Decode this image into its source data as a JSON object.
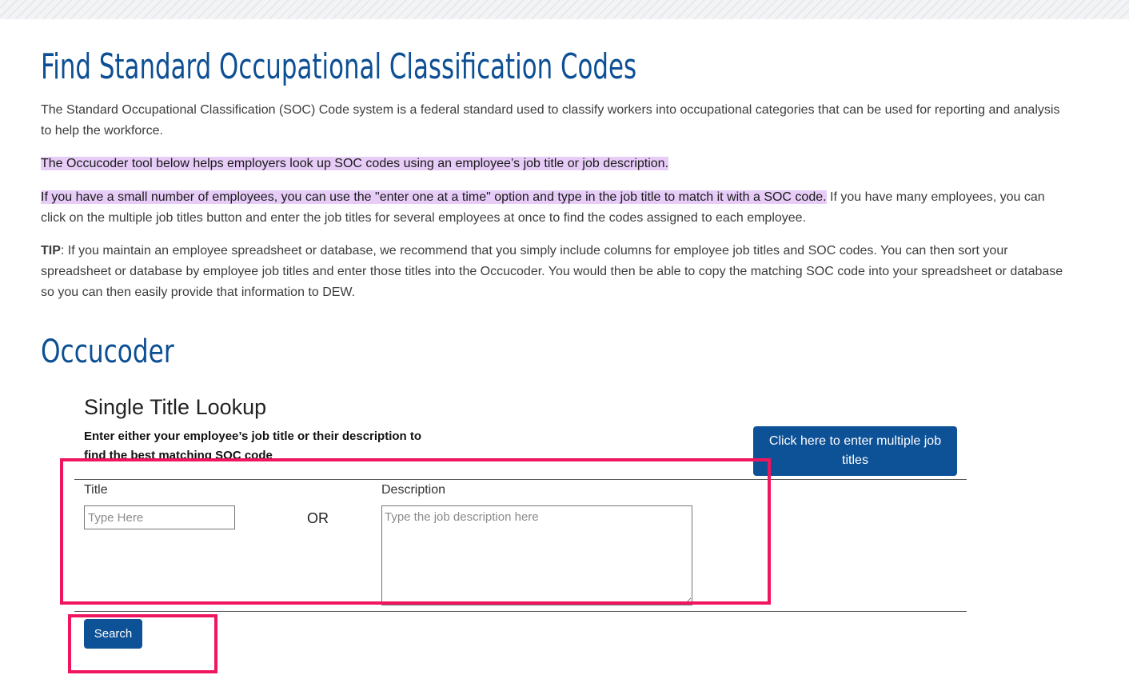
{
  "page": {
    "title": "Find Standard Occupational Classification Codes",
    "intro": "The Standard Occupational Classification (SOC) Code system is a federal standard used to classify workers into occupational categories that can be used for reporting and analysis to help the workforce.",
    "tool_note": "The Occucoder tool below helps employers look up SOC codes using an employee’s job title or job description.",
    "small_count_highlight": "If you have a small number of employees, you can use the \"enter one at a time\" option and type in the job title to match it with a SOC code.",
    "many_count_text": " If you have many employees, you can click on the multiple job titles button and enter the job titles for several employees at once to find the codes assigned to each employee.",
    "tip_label": "TIP",
    "tip_text": ": If you maintain an employee spreadsheet or database, we recommend that you simply include columns for employee job titles and SOC codes. You can then sort your spreadsheet or database by employee job titles and enter those titles into the Occucoder. You would then be able to copy the matching SOC code into your spreadsheet or database so you can then easily provide that information to DEW."
  },
  "occucoder": {
    "heading": "Occucoder",
    "lookup_title": "Single Title Lookup",
    "instructions": "Enter either your employee’s job title or their description to find the best matching SOC code",
    "multiple_button": "Click here to enter multiple job titles",
    "title_label": "Title",
    "title_placeholder": "Type Here",
    "or_label": "OR",
    "description_label": "Description",
    "description_placeholder": "Type the job description here",
    "search_button": "Search"
  },
  "colors": {
    "heading_blue": "#0d4f94",
    "button_blue": "#0d5196",
    "highlight_purple": "#e6ccf7",
    "annotation_pink": "#f0165e"
  }
}
